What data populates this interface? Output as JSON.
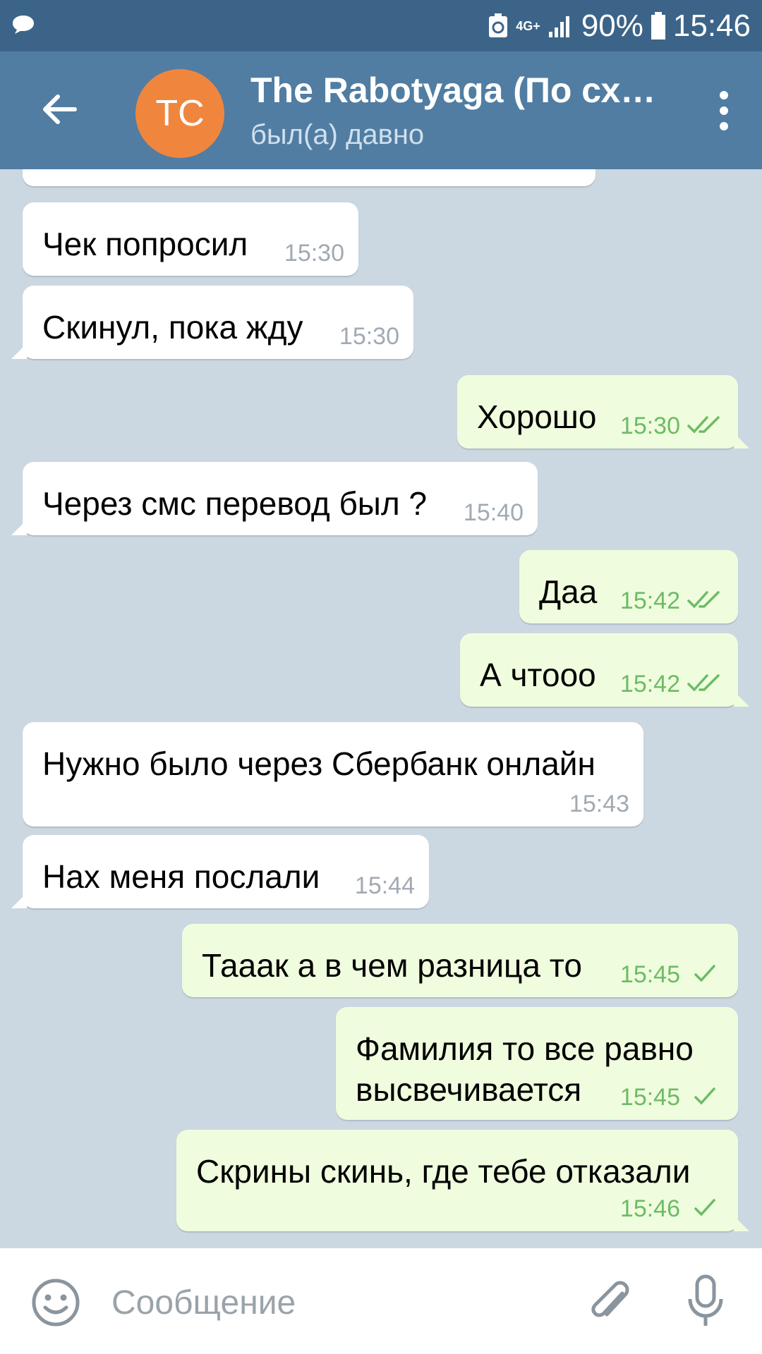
{
  "status_bar": {
    "network": "4G+",
    "battery": "90%",
    "time": "15:46"
  },
  "header": {
    "avatar_initials": "TC",
    "title": "The Rabotyaga (По сх…",
    "subtitle": "был(а) давно"
  },
  "messages": [
    {
      "dir": "in",
      "text": "Чек попросил",
      "time": "15:30"
    },
    {
      "dir": "in",
      "text": "Скинул, пока жду",
      "time": "15:30"
    },
    {
      "dir": "out",
      "text": "Хорошо",
      "time": "15:30",
      "status": "read"
    },
    {
      "dir": "in",
      "text": "Через смс перевод был ?",
      "time": "15:40"
    },
    {
      "dir": "out",
      "text": "Даа",
      "time": "15:42",
      "status": "read"
    },
    {
      "dir": "out",
      "text": "А чтооо",
      "time": "15:42",
      "status": "read"
    },
    {
      "dir": "in",
      "text": "Нужно было через Сбербанк онлайн",
      "time": "15:43"
    },
    {
      "dir": "in",
      "text": "Нах меня послали",
      "time": "15:44"
    },
    {
      "dir": "out",
      "text": "Тааак а в чем разница то",
      "time": "15:45",
      "status": "sent"
    },
    {
      "dir": "out",
      "text": "Фамилия то все равно\nвысвечивается",
      "time": "15:45",
      "status": "sent"
    },
    {
      "dir": "out",
      "text": "Скрины скинь, где тебе отказали",
      "time": "15:46",
      "status": "sent"
    }
  ],
  "composer": {
    "placeholder": "Сообщение"
  },
  "icons": {
    "back": "arrow-left-icon",
    "menu": "more-vertical-icon",
    "emoji": "smiley-icon",
    "attach": "paperclip-icon",
    "mic": "microphone-icon"
  },
  "colors": {
    "header": "#517da2",
    "status_bar": "#3c6488",
    "incoming_bubble": "#ffffff",
    "outgoing_bubble": "#effdde",
    "outgoing_time": "#6dbb65",
    "avatar": "#f0863d"
  }
}
